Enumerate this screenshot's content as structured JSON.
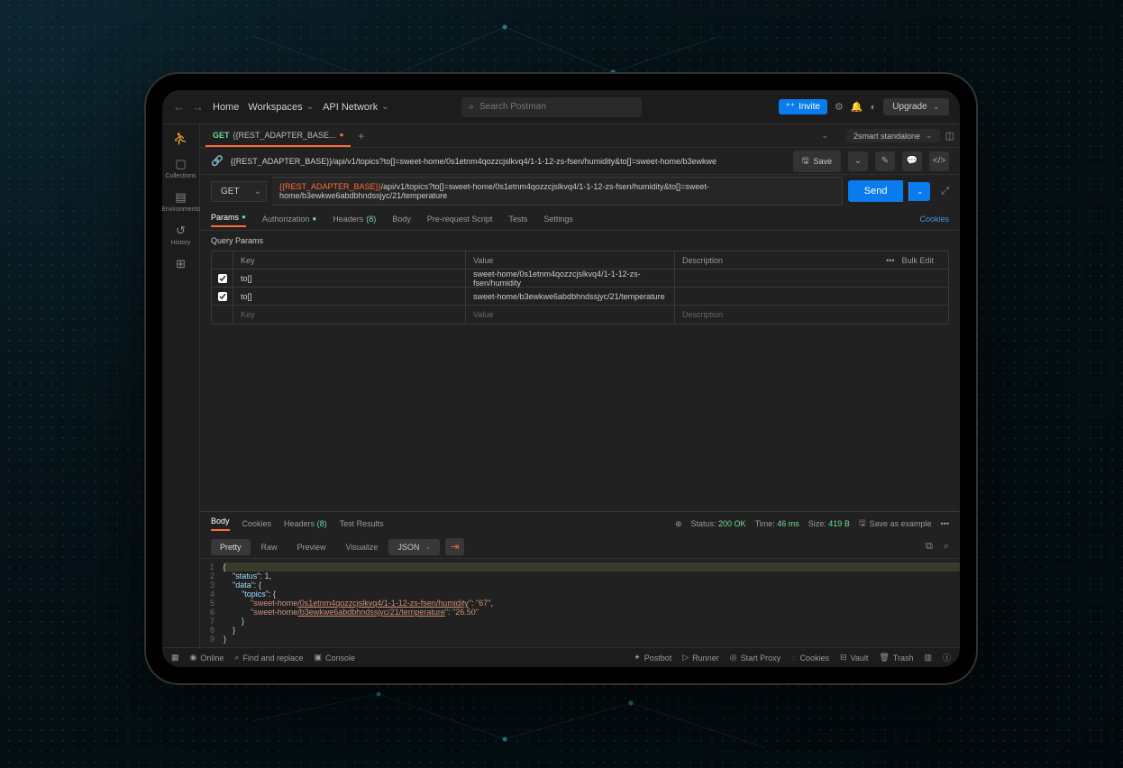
{
  "top": {
    "home": "Home",
    "workspaces": "Workspaces",
    "api_network": "API Network",
    "search_placeholder": "Search Postman",
    "invite": "Invite",
    "upgrade": "Upgrade"
  },
  "rail": {
    "collections": "Collections",
    "environments": "Environments",
    "history": "History"
  },
  "tab": {
    "method": "GET",
    "name": "{{REST_ADAPTER_BASE..."
  },
  "env": {
    "name": "2smart standalone"
  },
  "breadcrumb": {
    "var": "{{REST_ADAPTER_BASE}}",
    "path": "/api/v1/topics?to[]=sweet-home/0s1etnm4qozzcjslkvq4/1-1-12-zs-fsen/humidity&to[]=sweet-home/b3ewkwe",
    "save": "Save"
  },
  "url": {
    "method": "GET",
    "var": "{{REST_ADAPTER_BASE}}",
    "path": "/api/v1/topics?to[]=sweet-home/0s1etnm4qozzcjslkvq4/1-1-12-zs-fsen/humidity&to[]=sweet-home/b3ewkwe6abdbhndssjyc/21/temperature",
    "send": "Send"
  },
  "subtabs": {
    "params": "Params",
    "authorization": "Authorization",
    "headers": "Headers",
    "headers_count": "(8)",
    "body": "Body",
    "prerequest": "Pre-request Script",
    "tests": "Tests",
    "settings": "Settings",
    "cookies": "Cookies"
  },
  "query_params_label": "Query Params",
  "params_header": {
    "key": "Key",
    "value": "Value",
    "description": "Description",
    "more": "•••",
    "bulk": "Bulk Edit"
  },
  "params": [
    {
      "key": "to[]",
      "value": "sweet-home/0s1etnm4qozzcjslkvq4/1-1-12-zs-fsen/humidity"
    },
    {
      "key": "to[]",
      "value": "sweet-home/b3ewkwe6abdbhndssjyc/21/temperature"
    }
  ],
  "params_placeholder": {
    "key": "Key",
    "value": "Value",
    "description": "Description"
  },
  "response": {
    "tabs": {
      "body": "Body",
      "cookies": "Cookies",
      "headers": "Headers",
      "headers_count": "(8)",
      "test_results": "Test Results"
    },
    "meta": {
      "status_label": "Status:",
      "status": "200 OK",
      "time_label": "Time:",
      "time": "46 ms",
      "size_label": "Size:",
      "size": "419 B",
      "save_example": "Save as example"
    },
    "toolbar": {
      "pretty": "Pretty",
      "raw": "Raw",
      "preview": "Preview",
      "visualize": "Visualize",
      "format": "JSON"
    },
    "json": {
      "status_key": "\"status\"",
      "status_val": "1",
      "data_key": "\"data\"",
      "topics_key": "\"topics\"",
      "k1a": "\"sweet-home",
      "k1b": "/0s1etnm4qozzcjslkvq4/1-1-12-zs-fsen/humidity",
      "v1": "\"67\"",
      "k2a": "\"sweet-home",
      "k2b": "/b3ewkwe6abdbhndssjyc/21/temperature",
      "v2": "\"26.50\""
    }
  },
  "statusbar": {
    "online": "Online",
    "find": "Find and replace",
    "console": "Console",
    "postbot": "Postbot",
    "runner": "Runner",
    "proxy": "Start Proxy",
    "cookies": "Cookies",
    "vault": "Vault",
    "trash": "Trash"
  }
}
